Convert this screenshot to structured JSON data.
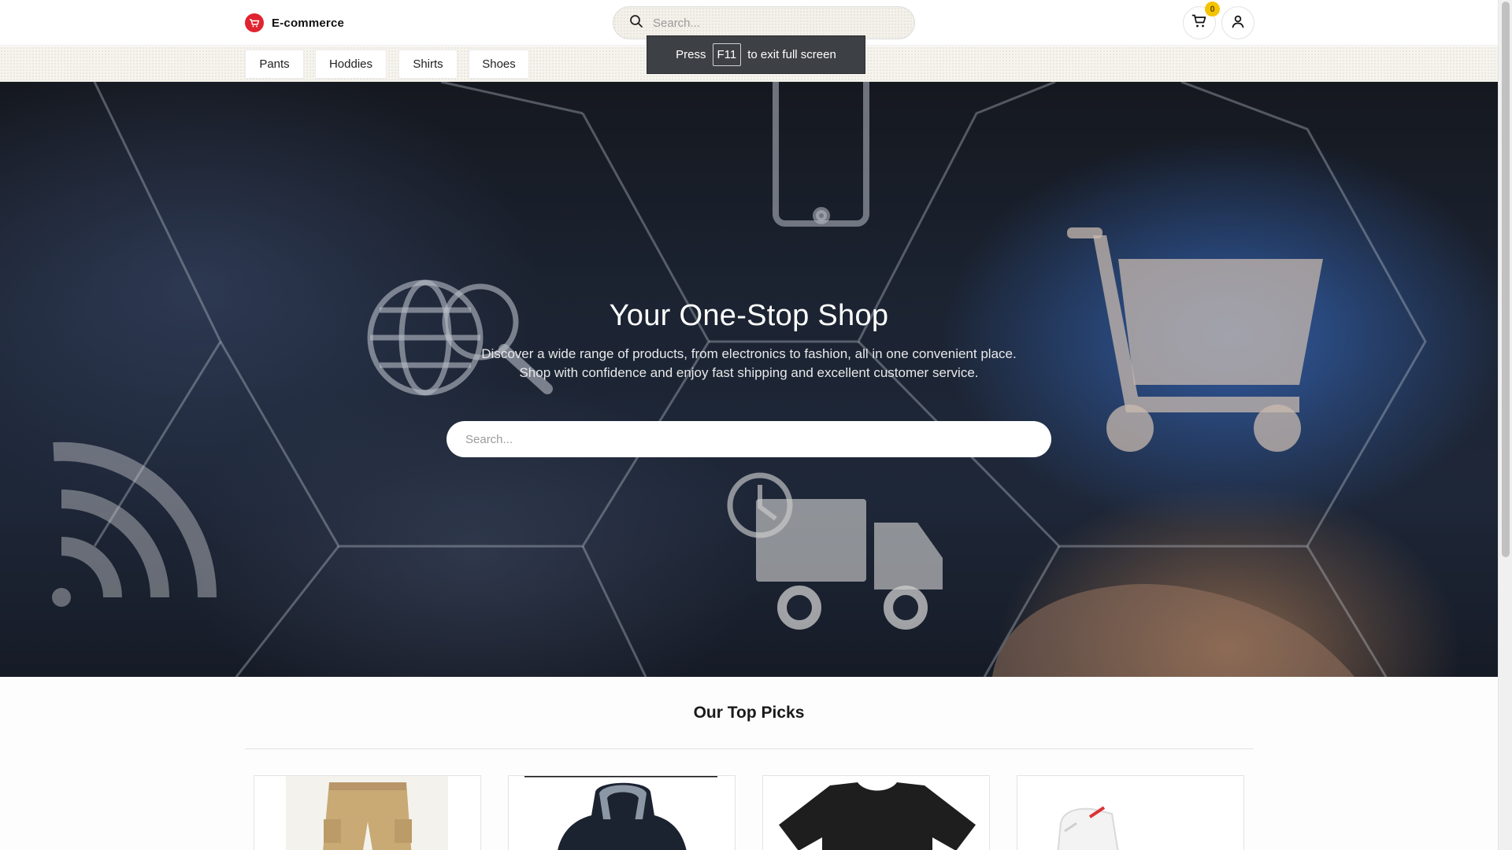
{
  "header": {
    "brand": "E-commerce",
    "search_placeholder": "Search...",
    "cart_count": "0"
  },
  "categories": [
    "Pants",
    "Hoddies",
    "Shirts",
    "Shoes"
  ],
  "fullscreen_toast": {
    "before": "Press",
    "key": "F11",
    "after": "to exit full screen"
  },
  "hero": {
    "title": "Your One-Stop Shop",
    "subtitle_line1": "Discover a wide range of products, from electronics to fashion, all in one convenient place.",
    "subtitle_line2": "Shop with confidence and enjoy fast shipping and excellent customer service.",
    "search_placeholder": "Search..."
  },
  "top_picks": {
    "title": "Our Top Picks",
    "products": [
      {
        "icon": "cargo-shorts-image"
      },
      {
        "icon": "hoodie-image"
      },
      {
        "icon": "tshirt-image"
      },
      {
        "icon": "sneaker-image"
      }
    ]
  },
  "colors": {
    "brand_red": "#e0242f",
    "badge_yellow": "#f5c400",
    "hero_dark": "#1c2433"
  }
}
